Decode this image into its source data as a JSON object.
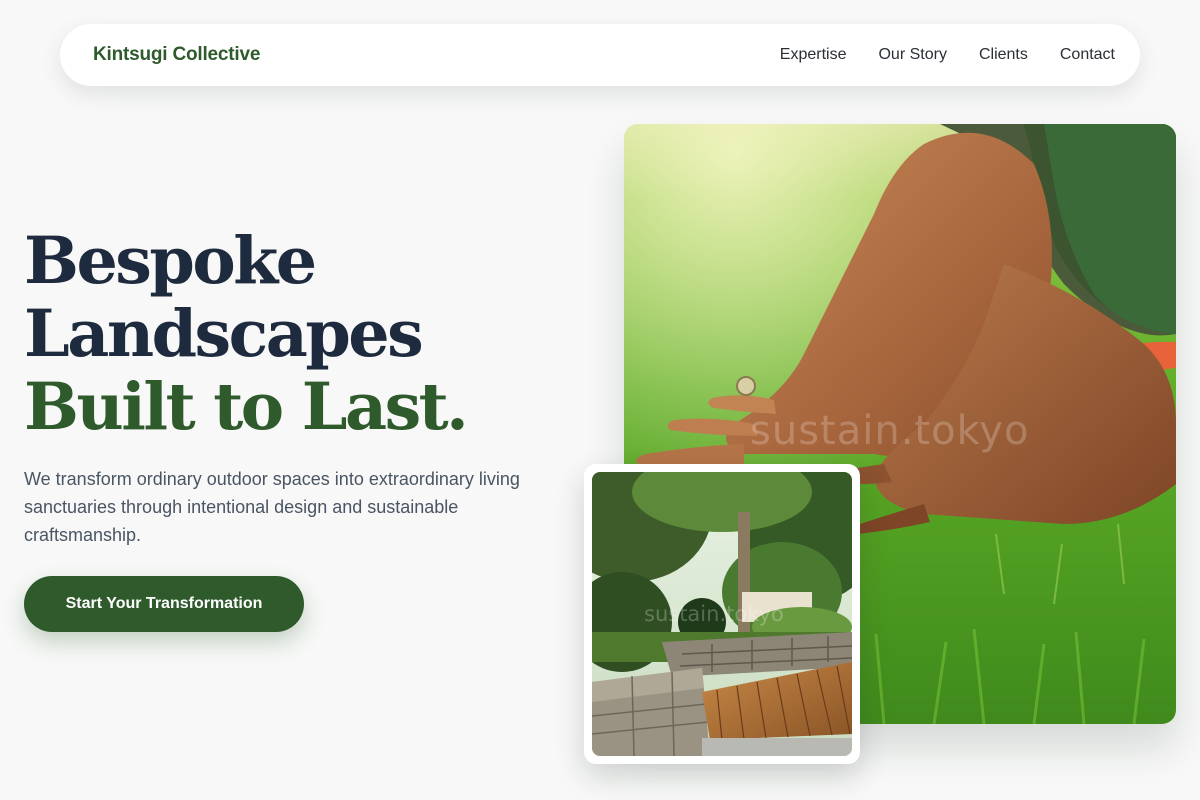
{
  "nav": {
    "brand": "Kintsugi Collective",
    "links": [
      "Expertise",
      "Our Story",
      "Clients",
      "Contact"
    ]
  },
  "hero": {
    "headline_line1": "Bespoke",
    "headline_line2": "Landscapes",
    "headline_accent": "Built to Last.",
    "subtext": "We transform ordinary outdoor spaces into extraordinary living sanctuaries through intentional design and sustainable craftsmanship.",
    "cta_label": "Start Your Transformation"
  },
  "images": {
    "main_watermark": "sustain.tokyo",
    "inset_watermark": "sustain.tokyo"
  },
  "colors": {
    "brand_green": "#2e5a2c",
    "headline_navy": "#1e2a3d",
    "body_text": "#4a5563",
    "page_background": "#f7f8f7"
  }
}
